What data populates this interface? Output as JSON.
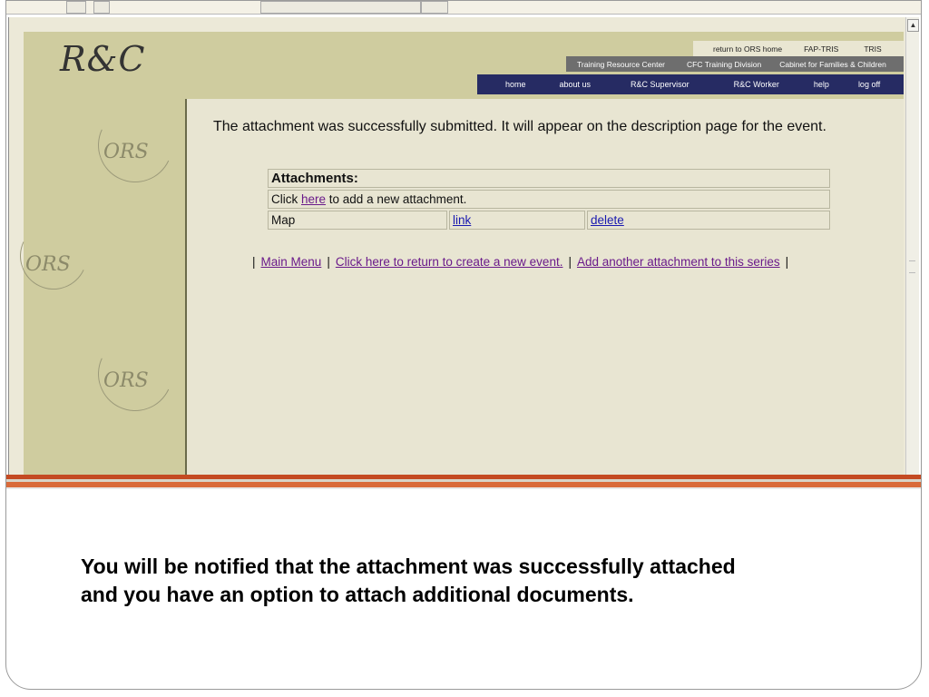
{
  "site": {
    "logo": "R&C",
    "watermark": "ORS",
    "nav_top": [
      {
        "label": "return to ORS home"
      },
      {
        "label": "FAP-TRIS"
      },
      {
        "label": "TRIS"
      }
    ],
    "nav_middle": [
      {
        "label": "Training Resource Center"
      },
      {
        "label": "CFC Training Division"
      },
      {
        "label": "Cabinet for Families & Children"
      }
    ],
    "nav_main": [
      {
        "label": "home"
      },
      {
        "label": "about us"
      },
      {
        "label": "R&C Supervisor"
      },
      {
        "label": "R&C Worker"
      },
      {
        "label": "help"
      },
      {
        "label": "log off"
      }
    ]
  },
  "content": {
    "success_message": "The attachment was successfully submitted. It will appear on the description page for the event.",
    "attachments": {
      "title": "Attachments:",
      "add_prefix": "Click ",
      "add_link": "here",
      "add_suffix": " to add a new attachment.",
      "rows": [
        {
          "name": "Map",
          "link_label": "link",
          "delete_label": "delete"
        }
      ]
    },
    "links": {
      "separator": "|",
      "main_menu": "Main Menu",
      "return_create": "Click here to return to create a new event.",
      "add_another": "Add another attachment to this series"
    }
  },
  "caption": {
    "line1": "You will be notified that the attachment was successfully attached",
    "line2": "and you have an option to attach additional documents."
  },
  "colors": {
    "header_band": "#cfcc9f",
    "nav_main_bg": "#262b63",
    "nav_middle_bg": "#6e6e6e",
    "accent_stripe": "#d96a3a"
  }
}
